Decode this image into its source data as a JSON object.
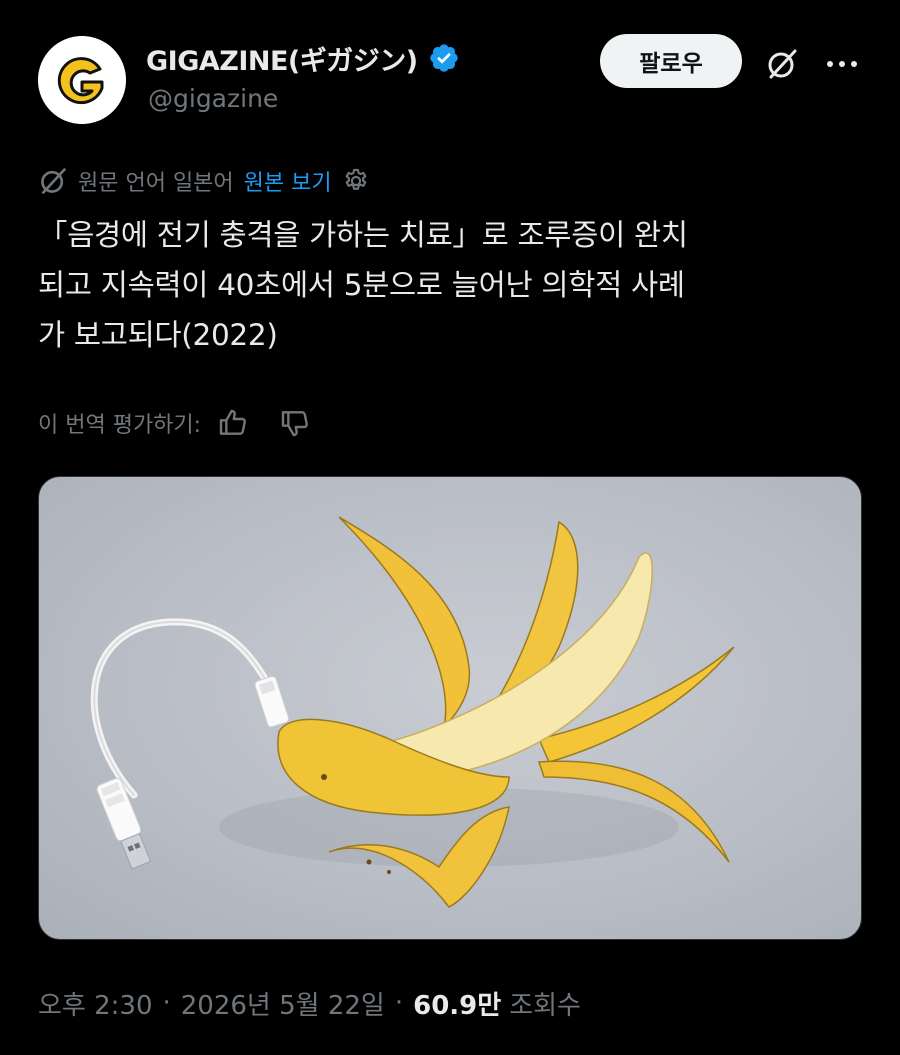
{
  "author": {
    "display_name": "GIGAZINE(ギガジン)",
    "handle": "@gigazine",
    "avatar_letter": "G",
    "verified": true
  },
  "actions": {
    "follow_label": "팔로우",
    "grok_icon": "grok-icon",
    "more_icon": "more-icon"
  },
  "translation": {
    "note": "원문 언어 일본어",
    "show_original": "원본 보기",
    "rate_label": "이 번역 평가하기:"
  },
  "tweet": {
    "lines": [
      "「음경에 전기 충격을 가하는 치료」로 조루증이 완치",
      "되고 지속력이 40초에서 5분으로 늘어난 의학적 사례",
      "가 보고되다(2022)"
    ]
  },
  "media": {
    "description_icon": "banana-usb-image"
  },
  "meta": {
    "time": "오후 2:30",
    "date": "2026년 5월 22일",
    "views_count": "60.9만",
    "views_label": "조회수"
  },
  "colors": {
    "background": "#000000",
    "accent_link": "#1d9bf0",
    "muted_text": "#71767b",
    "follow_bg": "#eff3f4",
    "verified_badge": "#1d9bf0",
    "avatar_logo_yellow": "#f3c21b"
  }
}
